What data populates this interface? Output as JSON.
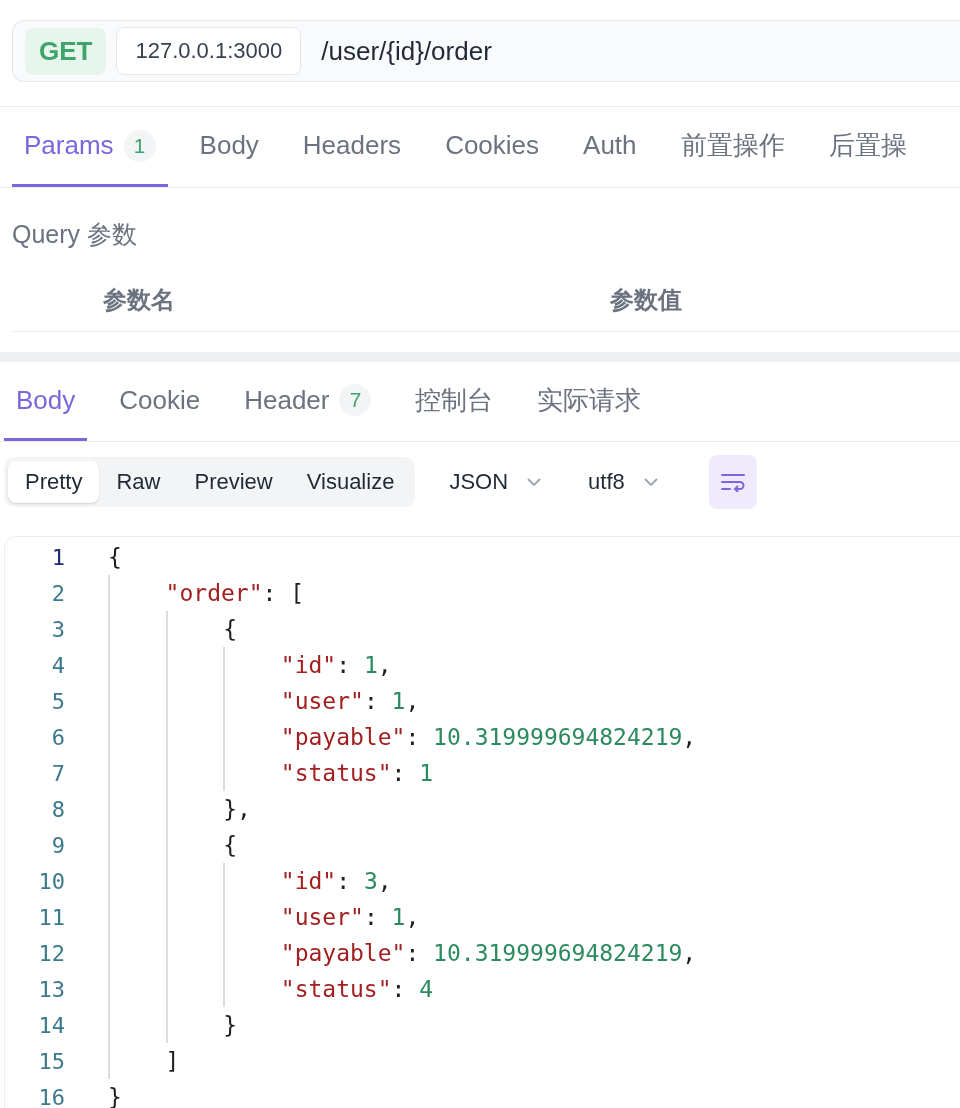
{
  "request": {
    "method": "GET",
    "host": "127.0.0.1:3000",
    "path": "/user/{id}/order"
  },
  "request_tabs": [
    {
      "label": "Params",
      "badge": "1",
      "selected": true
    },
    {
      "label": "Body",
      "selected": false
    },
    {
      "label": "Headers",
      "selected": false
    },
    {
      "label": "Cookies",
      "selected": false
    },
    {
      "label": "Auth",
      "selected": false
    },
    {
      "label": "前置操作",
      "selected": false
    },
    {
      "label": "后置操",
      "selected": false
    }
  ],
  "query_section": {
    "title": "Query 参数",
    "columns": [
      "参数名",
      "参数值"
    ]
  },
  "response_tabs": [
    {
      "label": "Body",
      "selected": true
    },
    {
      "label": "Cookie",
      "selected": false
    },
    {
      "label": "Header",
      "badge": "7",
      "selected": false
    },
    {
      "label": "控制台",
      "selected": false
    },
    {
      "label": "实际请求",
      "selected": false
    }
  ],
  "view_modes": [
    {
      "label": "Pretty",
      "selected": true
    },
    {
      "label": "Raw",
      "selected": false
    },
    {
      "label": "Preview",
      "selected": false
    },
    {
      "label": "Visualize",
      "selected": false
    }
  ],
  "dropdowns": [
    {
      "value": "JSON"
    },
    {
      "value": "utf8"
    }
  ],
  "wrap_button": {
    "on": true
  },
  "code_lines": [
    {
      "number": "1",
      "current": true,
      "tokens": [
        {
          "kind": "punct",
          "text": "{"
        }
      ],
      "children": [
        {
          "number": "2",
          "current": false,
          "tokens": [
            {
              "kind": "key",
              "text": "\"order\""
            },
            {
              "kind": "punct",
              "text": ": ["
            }
          ],
          "children": [
            {
              "number": "3",
              "current": false,
              "tokens": [
                {
                  "kind": "punct",
                  "text": "{"
                }
              ],
              "children": [
                {
                  "number": "4",
                  "current": false,
                  "tokens": [
                    {
                      "kind": "key",
                      "text": "\"id\""
                    },
                    {
                      "kind": "punct",
                      "text": ": "
                    },
                    {
                      "kind": "number",
                      "text": "1"
                    },
                    {
                      "kind": "punct",
                      "text": ","
                    }
                  ]
                },
                {
                  "number": "5",
                  "current": false,
                  "tokens": [
                    {
                      "kind": "key",
                      "text": "\"user\""
                    },
                    {
                      "kind": "punct",
                      "text": ": "
                    },
                    {
                      "kind": "number",
                      "text": "1"
                    },
                    {
                      "kind": "punct",
                      "text": ","
                    }
                  ]
                },
                {
                  "number": "6",
                  "current": false,
                  "tokens": [
                    {
                      "kind": "key",
                      "text": "\"payable\""
                    },
                    {
                      "kind": "punct",
                      "text": ": "
                    },
                    {
                      "kind": "number",
                      "text": "10.319999694824219"
                    },
                    {
                      "kind": "punct",
                      "text": ","
                    }
                  ]
                },
                {
                  "number": "7",
                  "current": false,
                  "tokens": [
                    {
                      "kind": "key",
                      "text": "\"status\""
                    },
                    {
                      "kind": "punct",
                      "text": ": "
                    },
                    {
                      "kind": "number",
                      "text": "1"
                    }
                  ]
                }
              ]
            },
            {
              "number": "8",
              "current": false,
              "tokens": [
                {
                  "kind": "punct",
                  "text": "},"
                }
              ]
            },
            {
              "number": "9",
              "current": false,
              "tokens": [
                {
                  "kind": "punct",
                  "text": "{"
                }
              ],
              "children": [
                {
                  "number": "10",
                  "current": false,
                  "tokens": [
                    {
                      "kind": "key",
                      "text": "\"id\""
                    },
                    {
                      "kind": "punct",
                      "text": ": "
                    },
                    {
                      "kind": "number",
                      "text": "3"
                    },
                    {
                      "kind": "punct",
                      "text": ","
                    }
                  ]
                },
                {
                  "number": "11",
                  "current": false,
                  "tokens": [
                    {
                      "kind": "key",
                      "text": "\"user\""
                    },
                    {
                      "kind": "punct",
                      "text": ": "
                    },
                    {
                      "kind": "number",
                      "text": "1"
                    },
                    {
                      "kind": "punct",
                      "text": ","
                    }
                  ]
                },
                {
                  "number": "12",
                  "current": false,
                  "tokens": [
                    {
                      "kind": "key",
                      "text": "\"payable\""
                    },
                    {
                      "kind": "punct",
                      "text": ": "
                    },
                    {
                      "kind": "number",
                      "text": "10.319999694824219"
                    },
                    {
                      "kind": "punct",
                      "text": ","
                    }
                  ]
                },
                {
                  "number": "13",
                  "current": false,
                  "tokens": [
                    {
                      "kind": "key",
                      "text": "\"status\""
                    },
                    {
                      "kind": "punct",
                      "text": ": "
                    },
                    {
                      "kind": "number",
                      "text": "4"
                    }
                  ]
                }
              ]
            },
            {
              "number": "14",
              "current": false,
              "tokens": [
                {
                  "kind": "punct",
                  "text": "}"
                }
              ]
            }
          ]
        },
        {
          "number": "15",
          "current": false,
          "tokens": [
            {
              "kind": "punct",
              "text": "]"
            }
          ]
        }
      ]
    },
    {
      "number": "16",
      "current": false,
      "tokens": [
        {
          "kind": "punct",
          "text": "}"
        }
      ]
    }
  ]
}
